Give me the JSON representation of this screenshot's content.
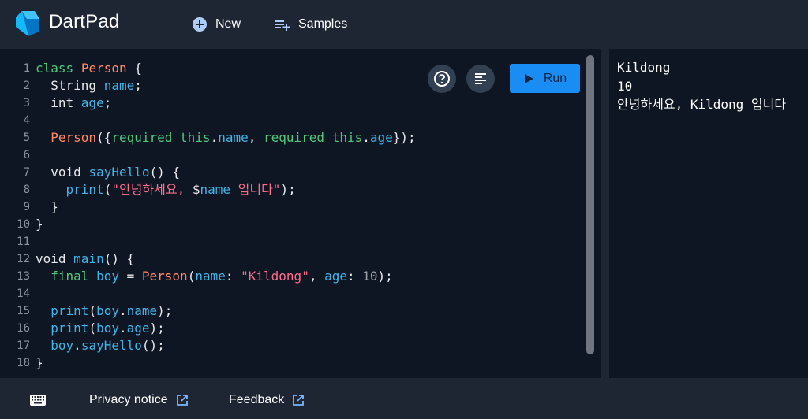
{
  "app": {
    "title": "DartPad"
  },
  "nav": {
    "new_label": "New",
    "samples_label": "Samples"
  },
  "toolbar": {
    "run_label": "Run"
  },
  "editor": {
    "lines": [
      [
        [
          "kw",
          "class"
        ],
        [
          "pl",
          " "
        ],
        [
          "ty",
          "Person"
        ],
        [
          "pl",
          " {"
        ]
      ],
      [
        [
          "pl",
          "  String "
        ],
        [
          "fn",
          "name"
        ],
        [
          "pl",
          ";"
        ]
      ],
      [
        [
          "pl",
          "  int "
        ],
        [
          "fn",
          "age"
        ],
        [
          "pl",
          ";"
        ]
      ],
      [],
      [
        [
          "pl",
          "  "
        ],
        [
          "ty",
          "Person"
        ],
        [
          "pl",
          "({"
        ],
        [
          "kw",
          "required"
        ],
        [
          "pl",
          " "
        ],
        [
          "kw",
          "this"
        ],
        [
          "pl",
          "."
        ],
        [
          "fn",
          "name"
        ],
        [
          "pl",
          ", "
        ],
        [
          "kw",
          "required"
        ],
        [
          "pl",
          " "
        ],
        [
          "kw",
          "this"
        ],
        [
          "pl",
          "."
        ],
        [
          "fn",
          "age"
        ],
        [
          "pl",
          "});"
        ]
      ],
      [],
      [
        [
          "pl",
          "  void "
        ],
        [
          "fn",
          "sayHello"
        ],
        [
          "pl",
          "() {"
        ]
      ],
      [
        [
          "pl",
          "    "
        ],
        [
          "fn",
          "print"
        ],
        [
          "pl",
          "("
        ],
        [
          "st",
          "\"안녕하세요, "
        ],
        [
          "pl",
          "$"
        ],
        [
          "fn",
          "name"
        ],
        [
          "st",
          " 입니다\""
        ],
        [
          "pl",
          ");"
        ]
      ],
      [
        [
          "pl",
          "  }"
        ]
      ],
      [
        [
          "pl",
          "}"
        ]
      ],
      [],
      [
        [
          "pl",
          "void "
        ],
        [
          "fn",
          "main"
        ],
        [
          "pl",
          "() {"
        ]
      ],
      [
        [
          "pl",
          "  "
        ],
        [
          "kw",
          "final"
        ],
        [
          "pl",
          " "
        ],
        [
          "fn",
          "boy"
        ],
        [
          "pl",
          " = "
        ],
        [
          "ty",
          "Person"
        ],
        [
          "pl",
          "("
        ],
        [
          "fn",
          "name"
        ],
        [
          "pl",
          ": "
        ],
        [
          "st",
          "\"Kildong\""
        ],
        [
          "pl",
          ", "
        ],
        [
          "fn",
          "age"
        ],
        [
          "pl",
          ": "
        ],
        [
          "nu",
          "10"
        ],
        [
          "pl",
          ");"
        ]
      ],
      [],
      [
        [
          "pl",
          "  "
        ],
        [
          "fn",
          "print"
        ],
        [
          "pl",
          "("
        ],
        [
          "fn",
          "boy"
        ],
        [
          "pl",
          "."
        ],
        [
          "fn",
          "name"
        ],
        [
          "pl",
          ");"
        ]
      ],
      [
        [
          "pl",
          "  "
        ],
        [
          "fn",
          "print"
        ],
        [
          "pl",
          "("
        ],
        [
          "fn",
          "boy"
        ],
        [
          "pl",
          "."
        ],
        [
          "fn",
          "age"
        ],
        [
          "pl",
          ");"
        ]
      ],
      [
        [
          "pl",
          "  "
        ],
        [
          "fn",
          "boy"
        ],
        [
          "pl",
          "."
        ],
        [
          "fn",
          "sayHello"
        ],
        [
          "pl",
          "();"
        ]
      ],
      [
        [
          "pl",
          "}"
        ]
      ]
    ]
  },
  "console": {
    "output": [
      "Kildong",
      "10",
      "안녕하세요, Kildong 입니다"
    ]
  },
  "footer": {
    "privacy_label": "Privacy notice",
    "feedback_label": "Feedback"
  },
  "colors": {
    "accent": "#1a8df5",
    "background": "#1e2633",
    "editor_bg": "#0f1623"
  },
  "icons": [
    "dart-logo-icon",
    "add-circle-icon",
    "playlist-add-icon",
    "help-icon",
    "format-icon",
    "play-icon",
    "keyboard-icon",
    "open-in-new-icon"
  ]
}
